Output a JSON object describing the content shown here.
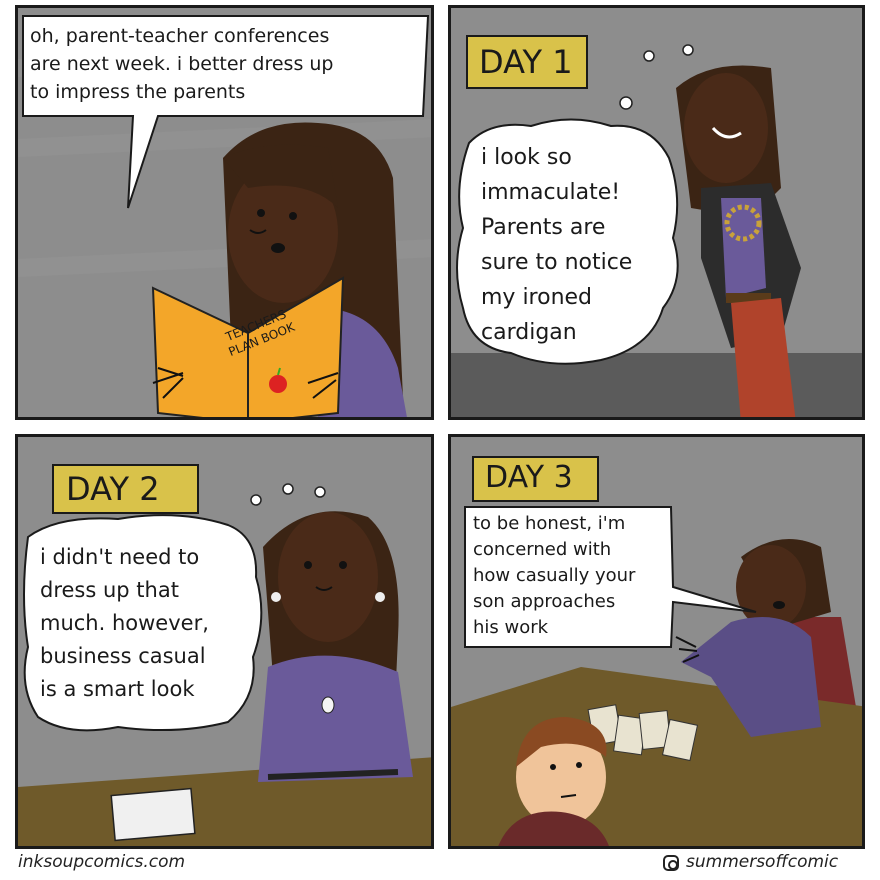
{
  "panels": [
    {
      "caption": "",
      "speech": "oh, parent-teacher conferences\nare next week. i better dress up\nto impress the parents",
      "book_title": "TEACHERS\nPLAN BOOK"
    },
    {
      "caption": "DAY 1",
      "thought": "i look so\nimmaculate!\nParents are\nsure to notice\nmy ironed\ncardigan"
    },
    {
      "caption": "DAY 2",
      "thought": "i didn't need to\ndress up that\nmuch. however,\nbusiness casual\nis a smart look"
    },
    {
      "caption": "DAY 3",
      "speech": "to be honest, i'm\nconcerned with\nhow casually your\nson approaches\nhis work"
    }
  ],
  "footer": {
    "left": "inksoupcomics.com",
    "right": "summersoffcomic",
    "right_icon": "instagram-icon"
  },
  "colors": {
    "background_wall": "#8f8f8f",
    "skin": "#4a2a18",
    "hair": "#3b2414",
    "cardigan": "#6a5a9a",
    "book": "#f3a629",
    "caption_box": "#d9c24a",
    "desk": "#6f5a2a",
    "skirt": "#b0432b"
  }
}
